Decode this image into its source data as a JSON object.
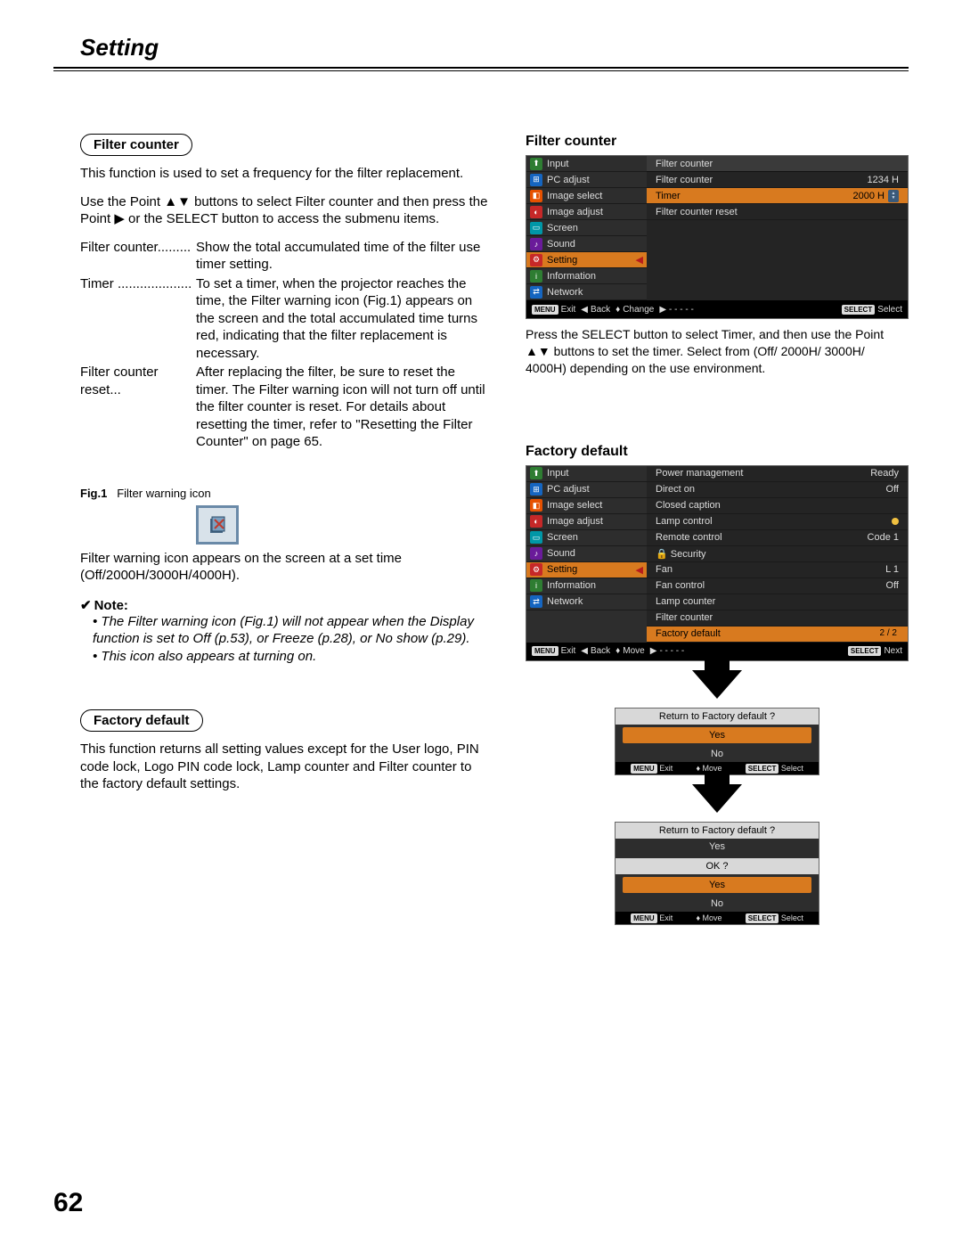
{
  "page": {
    "title": "Setting",
    "number": "62"
  },
  "filter": {
    "pill": "Filter counter",
    "intro": "This function is used to set a frequency for the filter replacement.",
    "use": "Use the Point ▲▼ buttons to select Filter counter and then press the Point ▶ or the SELECT button to access the submenu items.",
    "def1_label": "Filter counter.........",
    "def1_text": "Show the total accumulated time of the filter use timer setting.",
    "def2_label": "Timer ....................",
    "def2_text": "To set a timer, when the projector reaches the time, the Filter warning icon (Fig.1) appears on the screen and the total accumulated time turns red, indicating that the filter replacement is necessary.",
    "def3_label": "Filter counter reset...",
    "def3_text": "After replacing the filter, be sure to reset the timer. The Filter warning icon will not turn off until the filter counter is reset. For details about resetting the timer, refer to \"Resetting the Filter Counter\" on page 65.",
    "fig1_label_b": "Fig.1",
    "fig1_label": "Filter warning icon",
    "fig1_caption": "Filter warning icon appears on the screen at a set time (Off/2000H/3000H/4000H).",
    "note_head": "Note:",
    "note1": "The Filter warning icon (Fig.1) will not appear when the Display function is set to Off (p.53), or Freeze (p.28), or No show (p.29).",
    "note2": "This icon also appears at turning on."
  },
  "factory": {
    "pill": "Factory default",
    "body": "This function returns all setting values except for the User logo, PIN code lock, Logo PIN code lock, Lamp counter and Filter counter to the factory default settings."
  },
  "osd_common": {
    "side": [
      "Input",
      "PC adjust",
      "Image select",
      "Image adjust",
      "Screen",
      "Sound",
      "Setting",
      "Information",
      "Network"
    ]
  },
  "osd_filter": {
    "title": "Filter counter",
    "head": "Filter counter",
    "rows": [
      {
        "label": "Filter counter",
        "val": "1234 H"
      },
      {
        "label": "Timer",
        "val": "2000 H",
        "sel": true,
        "spinner": true
      },
      {
        "label": "Filter counter reset",
        "val": ""
      }
    ],
    "foot": {
      "exit": "Exit",
      "back": "Back",
      "change": "Change",
      "dash": "- - - - -",
      "select": "Select"
    },
    "caption": "Press the SELECT button to select  Timer, and then use the Point ▲▼ buttons to set the timer. Select from (Off/ 2000H/ 3000H/ 4000H) depending on the use environment."
  },
  "osd_factory": {
    "title": "Factory default",
    "rows": [
      {
        "label": "Power management",
        "val": "Ready"
      },
      {
        "label": "Direct on",
        "val": "Off"
      },
      {
        "label": "Closed caption",
        "val": ""
      },
      {
        "label": "Lamp control",
        "val": "",
        "dot": true
      },
      {
        "label": "Remote control",
        "val": "Code 1"
      },
      {
        "label": "Security",
        "val": "",
        "lock": true
      },
      {
        "label": "Fan",
        "val": "L 1"
      },
      {
        "label": "Fan control",
        "val": "Off"
      },
      {
        "label": "Lamp counter",
        "val": ""
      },
      {
        "label": "Filter counter",
        "val": ""
      },
      {
        "label": "Factory default",
        "val": "",
        "sel": true
      }
    ],
    "pager": "2 / 2",
    "foot": {
      "exit": "Exit",
      "back": "Back",
      "move": "Move",
      "dash": "- - - - -",
      "next": "Next"
    }
  },
  "dialog1": {
    "title": "Return to Factory default ?",
    "yes": "Yes",
    "no": "No",
    "foot": {
      "exit": "Exit",
      "move": "Move",
      "select": "Select"
    }
  },
  "dialog2": {
    "title": "Return to Factory default ?",
    "pre": "Yes",
    "ok": "OK ?",
    "yes": "Yes",
    "no": "No",
    "foot": {
      "exit": "Exit",
      "move": "Move",
      "select": "Select"
    }
  },
  "btn": {
    "menu": "MENU",
    "select": "SELECT"
  }
}
